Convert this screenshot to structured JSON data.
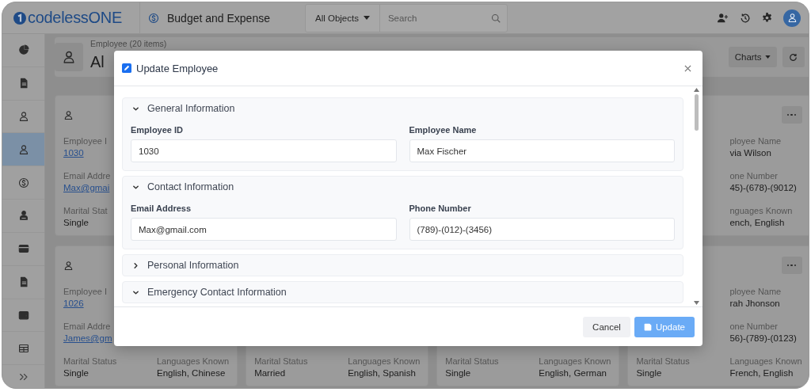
{
  "topbar": {
    "logo": "codelessONE",
    "app_name": "Budget and Expense",
    "object_filter": "All Objects",
    "search": {
      "placeholder": "Search"
    }
  },
  "sidebar": {
    "items": [
      {
        "selected": false
      },
      {
        "selected": false
      },
      {
        "selected": false
      },
      {
        "selected": true
      },
      {
        "selected": false
      },
      {
        "selected": false
      },
      {
        "selected": false
      },
      {
        "selected": false
      },
      {
        "selected": false
      },
      {
        "selected": false
      }
    ]
  },
  "header": {
    "subtitle": "Employee (20 items)",
    "title": "Al",
    "charts_button": "Charts"
  },
  "cards": [
    {
      "icon": true,
      "employee_id": {
        "label": "Employee I",
        "value": "1030"
      },
      "email": {
        "label": "Email Addre",
        "value": "Max@gmai"
      },
      "marital_status": {
        "label": "Marital Stat",
        "value": "Single"
      }
    },
    {
      "menu_button": true,
      "employee_name": {
        "label": "ployee Name",
        "value": "via Wilson"
      },
      "phone": {
        "label": "one Number",
        "value": "45)-(678)-(9012)"
      },
      "languages": {
        "label": "nguages Known",
        "value": "ench, English"
      }
    },
    {
      "icon": true,
      "employee_id": {
        "label": "Employee I",
        "value": "1026"
      },
      "email": {
        "label": "Email Addre",
        "value": "James@gm"
      },
      "marital_status": {
        "label": "Marital Status",
        "value": "Single"
      },
      "languages": {
        "label": "Languages Known",
        "value": "English, Chinese"
      }
    },
    {
      "marital_status": {
        "label": "Marital Status",
        "value": "Married"
      },
      "languages": {
        "label": "Languages Known",
        "value": "English, Spanish"
      }
    },
    {
      "marital_status": {
        "label": "Marital Status",
        "value": "Single"
      },
      "languages": {
        "label": "Languages Known",
        "value": "English, German"
      }
    },
    {
      "menu_button": true,
      "employee_name": {
        "label": "ployee Name",
        "value": "rah Jhonson"
      },
      "phone": {
        "label": "one Number",
        "value": "56)-(789)-(0123)"
      },
      "marital_status": {
        "label": "Marital Status",
        "value": "Single"
      },
      "languages": {
        "label": "Languages Known",
        "value": "French, English"
      }
    }
  ],
  "modal": {
    "title": "Update Employee",
    "sections": [
      {
        "title": "General Information",
        "expanded": true,
        "fields": [
          {
            "label": "Employee ID",
            "value": "1030"
          },
          {
            "label": "Employee Name",
            "value": "Max Fischer"
          }
        ]
      },
      {
        "title": "Contact Information",
        "expanded": true,
        "fields": [
          {
            "label": "Email Address",
            "value": "Max@gmail.com"
          },
          {
            "label": "Phone Number",
            "value": "(789)-(012)-(3456)"
          }
        ]
      },
      {
        "title": "Personal Information",
        "expanded": false
      },
      {
        "title": "Emergency Contact Information",
        "expanded": true
      }
    ],
    "buttons": [
      {
        "label": "Cancel",
        "kind": "secondary",
        "disabled": false
      },
      {
        "label": "Update",
        "kind": "primary",
        "disabled": true
      }
    ]
  }
}
